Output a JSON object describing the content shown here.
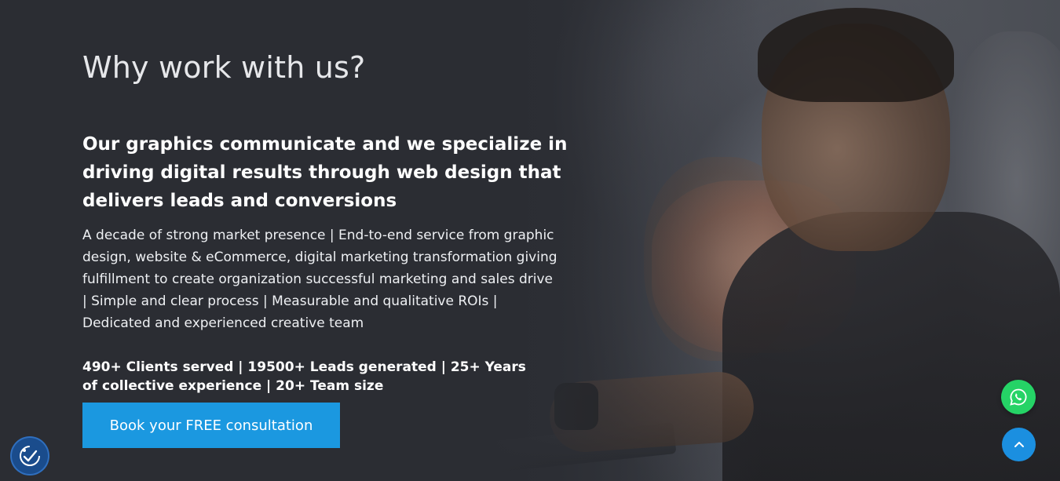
{
  "section": {
    "title": "Why work with us?",
    "subheading": "Our graphics communicate and we specialize in driving digital results through web design that delivers leads and conversions",
    "description": "A decade of strong market presence | End-to-end service from graphic design, website & eCommerce, digital marketing transformation giving fulfillment to create organization successful marketing and sales drive | Simple and clear process | Measurable and qualitative ROIs | Dedicated and experienced creative team",
    "stats": "490+ Clients served | 19500+ Leads generated | 25+ Years of collective experience | 20+ Team size",
    "cta_label": "Book your FREE consultation"
  },
  "floating_buttons": {
    "whatsapp_icon": "whatsapp-icon",
    "scroll_top_icon": "chevron-up-icon",
    "accessibility_icon": "accessibility-check-icon"
  },
  "colors": {
    "background": "#2b2d33",
    "cta": "#1b98e0",
    "whatsapp": "#25d366",
    "scroll_top": "#1b8fe0",
    "accessibility": "#1a4c8c"
  }
}
